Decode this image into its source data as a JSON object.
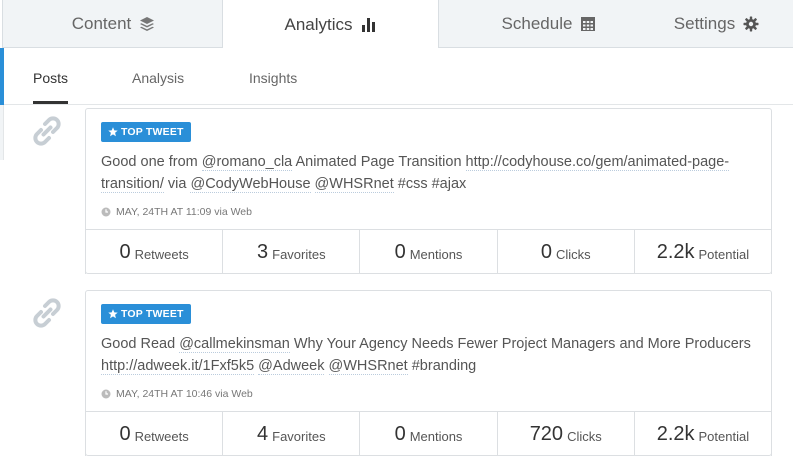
{
  "top_tabs": [
    {
      "label": "Content",
      "icon": "layers-icon"
    },
    {
      "label": "Analytics",
      "icon": "bar-chart-icon"
    },
    {
      "label": "Schedule",
      "icon": "calendar-icon"
    },
    {
      "label": "Settings",
      "icon": "gear-icon"
    }
  ],
  "sub_tabs": [
    {
      "label": "Posts"
    },
    {
      "label": "Analysis"
    },
    {
      "label": "Insights"
    }
  ],
  "colors": {
    "accent": "#2a8fd8"
  },
  "posts": [
    {
      "badge": "TOP TWEET",
      "text": {
        "pre": "Good one from ",
        "mention1": "@romano_cla",
        "mid1": " Animated Page Transition ",
        "link": "http://codyhouse.co/gem/animated-page-transition/",
        "mid2": " via ",
        "mention2": "@CodyWebHouse",
        "sp": " ",
        "mention3": "@WHSRnet",
        "tags": " #css #ajax"
      },
      "meta": "MAY, 24TH AT 11:09 via Web",
      "stats": [
        {
          "value": "0",
          "label": "Retweets"
        },
        {
          "value": "3",
          "label": "Favorites"
        },
        {
          "value": "0",
          "label": "Mentions"
        },
        {
          "value": "0",
          "label": "Clicks"
        },
        {
          "value": "2.2k",
          "label": "Potential"
        }
      ]
    },
    {
      "badge": "TOP TWEET",
      "text": {
        "pre": "Good Read ",
        "mention1": "@callmekinsman",
        "mid1": " Why Your Agency Needs Fewer Project Managers and More Producers ",
        "link": "http://adweek.it/1Fxf5k5",
        "mid2": " ",
        "mention2": "@Adweek",
        "sp": " ",
        "mention3": "@WHSRnet",
        "tags": " #branding"
      },
      "meta": "MAY, 24TH AT 10:46 via Web",
      "stats": [
        {
          "value": "0",
          "label": "Retweets"
        },
        {
          "value": "4",
          "label": "Favorites"
        },
        {
          "value": "0",
          "label": "Mentions"
        },
        {
          "value": "720",
          "label": "Clicks"
        },
        {
          "value": "2.2k",
          "label": "Potential"
        }
      ]
    }
  ]
}
